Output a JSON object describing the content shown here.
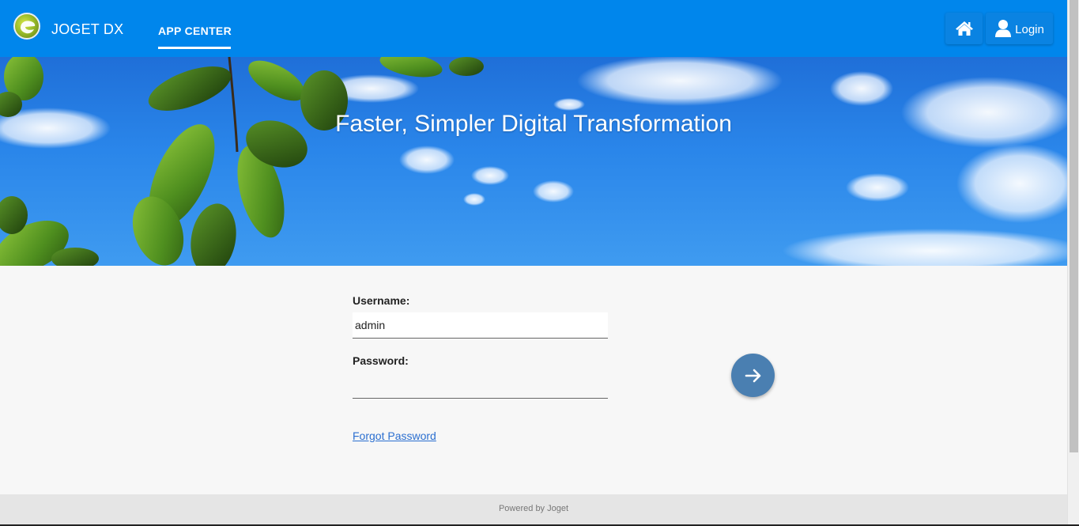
{
  "header": {
    "brand": "JOGET DX",
    "nav_tab": "APP CENTER",
    "home_icon": "home-icon",
    "login_label": "Login",
    "user_icon": "user-icon"
  },
  "hero": {
    "title": "Faster, Simpler Digital Transformation"
  },
  "login_form": {
    "username_label": "Username:",
    "username_value": "admin",
    "password_label": "Password:",
    "password_value": "",
    "forgot_password": "Forgot Password",
    "submit_icon": "arrow-right-icon"
  },
  "footer": {
    "text": "Powered by Joget"
  },
  "colors": {
    "header_bg": "#0086ec",
    "submit_bg": "#4a7fb1",
    "link": "#2b6fd0",
    "footer_bg": "#e5e5e5"
  }
}
